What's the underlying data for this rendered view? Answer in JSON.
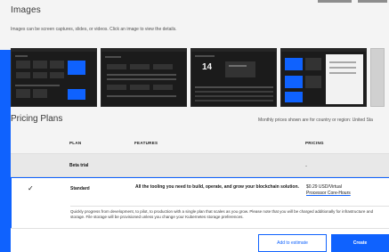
{
  "images_section": {
    "title": "Images",
    "description": "Images can be screen captures, slides, or videos. Click an image to view the details.",
    "thumb_3_value": "14"
  },
  "pricing": {
    "title": "Pricing Plans",
    "note": "Monthly prices shown are for country or region: United Sta",
    "headers": {
      "plan": "PLAN",
      "features": "FEATURES",
      "pricing": "PRICING"
    },
    "trial": {
      "plan": "Beta trial",
      "price": "-"
    },
    "standard": {
      "check": "✓",
      "plan": "Standard",
      "features": "All the tooling you need to build, operate, and grow your blockchain solution.",
      "price_line1": "$0.29 USD/Virtual",
      "price_line2": "Processor Core-Hours",
      "description": "Quickly progress from development, to pilot, to production with a single plan that scales as you grow. Please note that you will be charged additionally for infrastructure and storage. File storage will be provisioned unless you change your Kubernetes storage preferences."
    }
  },
  "footer": {
    "add_to_estimate": "Add to estimate",
    "create": "Create"
  },
  "colors": {
    "accent": "#0f62fe",
    "thumb_bg": "#1b1b1b"
  }
}
